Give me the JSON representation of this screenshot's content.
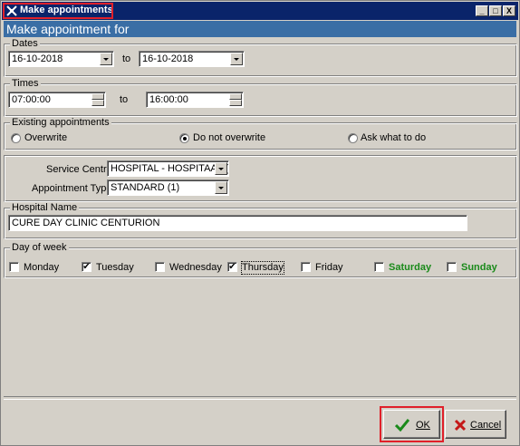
{
  "window": {
    "title": "Make appointments",
    "minimize": "_",
    "maximize": "□",
    "close": "X",
    "banner": "Make appointment for"
  },
  "dates": {
    "legend": "Dates",
    "from": "16-10-2018",
    "to_label": "to",
    "to": "16-10-2018"
  },
  "times": {
    "legend": "Times",
    "from": "07:00:00",
    "to_label": "to",
    "to": "16:00:00"
  },
  "existing": {
    "legend": "Existing appointments",
    "options": [
      "Overwrite",
      "Do not overwrite",
      "Ask what to do"
    ],
    "selected": "Do not overwrite"
  },
  "service": {
    "centre_label": "Service Centre:",
    "centre_value": "HOSPITAL - HOSPITAAL (:",
    "type_label": "Appointment Type:",
    "type_value": "STANDARD (1)"
  },
  "hospital": {
    "legend": "Hospital Name",
    "value": "CURE DAY CLINIC CENTURION"
  },
  "days": {
    "legend": "Day of week",
    "items": [
      {
        "label": "Monday",
        "checked": false
      },
      {
        "label": "Tuesday",
        "checked": true
      },
      {
        "label": "Wednesday",
        "checked": false
      },
      {
        "label": "Thursday",
        "checked": true
      },
      {
        "label": "Friday",
        "checked": false
      },
      {
        "label": "Saturday",
        "checked": false
      },
      {
        "label": "Sunday",
        "checked": false
      }
    ],
    "weekend_color": "#1a8a1a"
  },
  "buttons": {
    "ok": "OK",
    "cancel": "Cancel"
  }
}
